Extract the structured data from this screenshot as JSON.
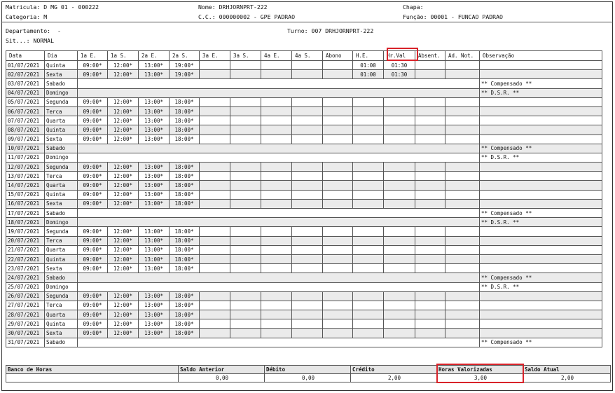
{
  "header": {
    "matricula_label": "Matricula:",
    "matricula_value": "D MG 01 - 000222",
    "nome_label": "Nome:",
    "nome_value": "DRHJORNPRT-222",
    "chapa_label": "Chapa:",
    "categoria_label": "Categoria:",
    "categoria_value": "M",
    "cc_label": "C.C.:",
    "cc_value": "000000002 - GPE PADRAO",
    "funcao_label": "Função:",
    "funcao_value": "00001 - FUNCAO PADRAO",
    "departamento_label": "Departamento:",
    "departamento_value": "-",
    "turno_label": "Turno:",
    "turno_value": "007 DRHJORNPRT-222",
    "sit_label": "Sit...:",
    "sit_value": "NORMAL"
  },
  "columns": [
    "Data",
    "Dia",
    "1a E.",
    "1a S.",
    "2a E.",
    "2a S.",
    "3a E.",
    "3a S.",
    "4a E.",
    "4a S.",
    "Abono",
    "H.E.",
    "Hr.Val",
    "Absent.",
    "Ad. Not.",
    "Observação"
  ],
  "rows": [
    {
      "data": "01/07/2021",
      "dia": "Quinta",
      "e1": "09:00*",
      "s1": "12:00*",
      "e2": "13:00*",
      "s2": "19:00*",
      "he": "01:00",
      "hrval": "01:30",
      "obs": ""
    },
    {
      "data": "02/07/2021",
      "dia": "Sexta",
      "e1": "09:00*",
      "s1": "12:00*",
      "e2": "13:00*",
      "s2": "19:00*",
      "he": "01:00",
      "hrval": "01:30",
      "obs": ""
    },
    {
      "data": "03/07/2021",
      "dia": "Sabado",
      "e1": "",
      "s1": "",
      "e2": "",
      "s2": "",
      "he": "",
      "hrval": "",
      "obs": "** Compensado **"
    },
    {
      "data": "04/07/2021",
      "dia": "Domingo",
      "e1": "",
      "s1": "",
      "e2": "",
      "s2": "",
      "he": "",
      "hrval": "",
      "obs": "** D.S.R. **"
    },
    {
      "data": "05/07/2021",
      "dia": "Segunda",
      "e1": "09:00*",
      "s1": "12:00*",
      "e2": "13:00*",
      "s2": "18:00*",
      "he": "",
      "hrval": "",
      "obs": ""
    },
    {
      "data": "06/07/2021",
      "dia": "Terca",
      "e1": "09:00*",
      "s1": "12:00*",
      "e2": "13:00*",
      "s2": "18:00*",
      "he": "",
      "hrval": "",
      "obs": ""
    },
    {
      "data": "07/07/2021",
      "dia": "Quarta",
      "e1": "09:00*",
      "s1": "12:00*",
      "e2": "13:00*",
      "s2": "18:00*",
      "he": "",
      "hrval": "",
      "obs": ""
    },
    {
      "data": "08/07/2021",
      "dia": "Quinta",
      "e1": "09:00*",
      "s1": "12:00*",
      "e2": "13:00*",
      "s2": "18:00*",
      "he": "",
      "hrval": "",
      "obs": ""
    },
    {
      "data": "09/07/2021",
      "dia": "Sexta",
      "e1": "09:00*",
      "s1": "12:00*",
      "e2": "13:00*",
      "s2": "18:00*",
      "he": "",
      "hrval": "",
      "obs": ""
    },
    {
      "data": "10/07/2021",
      "dia": "Sabado",
      "e1": "",
      "s1": "",
      "e2": "",
      "s2": "",
      "he": "",
      "hrval": "",
      "obs": "** Compensado **"
    },
    {
      "data": "11/07/2021",
      "dia": "Domingo",
      "e1": "",
      "s1": "",
      "e2": "",
      "s2": "",
      "he": "",
      "hrval": "",
      "obs": "** D.S.R. **"
    },
    {
      "data": "12/07/2021",
      "dia": "Segunda",
      "e1": "09:00*",
      "s1": "12:00*",
      "e2": "13:00*",
      "s2": "18:00*",
      "he": "",
      "hrval": "",
      "obs": ""
    },
    {
      "data": "13/07/2021",
      "dia": "Terca",
      "e1": "09:00*",
      "s1": "12:00*",
      "e2": "13:00*",
      "s2": "18:00*",
      "he": "",
      "hrval": "",
      "obs": ""
    },
    {
      "data": "14/07/2021",
      "dia": "Quarta",
      "e1": "09:00*",
      "s1": "12:00*",
      "e2": "13:00*",
      "s2": "18:00*",
      "he": "",
      "hrval": "",
      "obs": ""
    },
    {
      "data": "15/07/2021",
      "dia": "Quinta",
      "e1": "09:00*",
      "s1": "12:00*",
      "e2": "13:00*",
      "s2": "18:00*",
      "he": "",
      "hrval": "",
      "obs": ""
    },
    {
      "data": "16/07/2021",
      "dia": "Sexta",
      "e1": "09:00*",
      "s1": "12:00*",
      "e2": "13:00*",
      "s2": "18:00*",
      "he": "",
      "hrval": "",
      "obs": ""
    },
    {
      "data": "17/07/2021",
      "dia": "Sabado",
      "e1": "",
      "s1": "",
      "e2": "",
      "s2": "",
      "he": "",
      "hrval": "",
      "obs": "** Compensado **"
    },
    {
      "data": "18/07/2021",
      "dia": "Domingo",
      "e1": "",
      "s1": "",
      "e2": "",
      "s2": "",
      "he": "",
      "hrval": "",
      "obs": "** D.S.R. **"
    },
    {
      "data": "19/07/2021",
      "dia": "Segunda",
      "e1": "09:00*",
      "s1": "12:00*",
      "e2": "13:00*",
      "s2": "18:00*",
      "he": "",
      "hrval": "",
      "obs": ""
    },
    {
      "data": "20/07/2021",
      "dia": "Terca",
      "e1": "09:00*",
      "s1": "12:00*",
      "e2": "13:00*",
      "s2": "18:00*",
      "he": "",
      "hrval": "",
      "obs": ""
    },
    {
      "data": "21/07/2021",
      "dia": "Quarta",
      "e1": "09:00*",
      "s1": "12:00*",
      "e2": "13:00*",
      "s2": "18:00*",
      "he": "",
      "hrval": "",
      "obs": ""
    },
    {
      "data": "22/07/2021",
      "dia": "Quinta",
      "e1": "09:00*",
      "s1": "12:00*",
      "e2": "13:00*",
      "s2": "18:00*",
      "he": "",
      "hrval": "",
      "obs": ""
    },
    {
      "data": "23/07/2021",
      "dia": "Sexta",
      "e1": "09:00*",
      "s1": "12:00*",
      "e2": "13:00*",
      "s2": "18:00*",
      "he": "",
      "hrval": "",
      "obs": ""
    },
    {
      "data": "24/07/2021",
      "dia": "Sabado",
      "e1": "",
      "s1": "",
      "e2": "",
      "s2": "",
      "he": "",
      "hrval": "",
      "obs": "** Compensado **"
    },
    {
      "data": "25/07/2021",
      "dia": "Domingo",
      "e1": "",
      "s1": "",
      "e2": "",
      "s2": "",
      "he": "",
      "hrval": "",
      "obs": "** D.S.R. **"
    },
    {
      "data": "26/07/2021",
      "dia": "Segunda",
      "e1": "09:00*",
      "s1": "12:00*",
      "e2": "13:00*",
      "s2": "18:00*",
      "he": "",
      "hrval": "",
      "obs": ""
    },
    {
      "data": "27/07/2021",
      "dia": "Terca",
      "e1": "09:00*",
      "s1": "12:00*",
      "e2": "13:00*",
      "s2": "18:00*",
      "he": "",
      "hrval": "",
      "obs": ""
    },
    {
      "data": "28/07/2021",
      "dia": "Quarta",
      "e1": "09:00*",
      "s1": "12:00*",
      "e2": "13:00*",
      "s2": "18:00*",
      "he": "",
      "hrval": "",
      "obs": ""
    },
    {
      "data": "29/07/2021",
      "dia": "Quinta",
      "e1": "09:00*",
      "s1": "12:00*",
      "e2": "13:00*",
      "s2": "18:00*",
      "he": "",
      "hrval": "",
      "obs": ""
    },
    {
      "data": "30/07/2021",
      "dia": "Sexta",
      "e1": "09:00*",
      "s1": "12:00*",
      "e2": "13:00*",
      "s2": "18:00*",
      "he": "",
      "hrval": "",
      "obs": ""
    },
    {
      "data": "31/07/2021",
      "dia": "Sabado",
      "e1": "",
      "s1": "",
      "e2": "",
      "s2": "",
      "he": "",
      "hrval": "",
      "obs": "** Compensado **"
    }
  ],
  "bank": {
    "labels": [
      "Banco de Horas",
      "Saldo Anterior",
      "Débito",
      "Crédito",
      "Horas Valorizadas",
      "Saldo Atual"
    ],
    "values": [
      "",
      "0,00",
      "0,00",
      "2,00",
      "3,00",
      "2,00"
    ]
  },
  "highlight_color": "#d8232a"
}
